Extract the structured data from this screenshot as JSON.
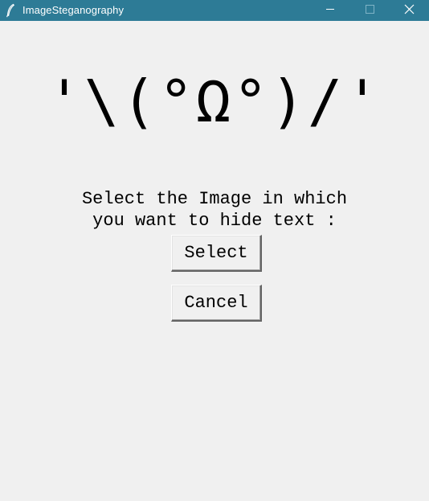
{
  "window": {
    "title": "ImageSteganography",
    "icon": "feather-icon",
    "controls": {
      "minimize": "minimize-icon",
      "maximize": "maximize-icon",
      "close": "close-icon"
    },
    "titlebar_color": "#2d7b96",
    "background_color": "#f0f0f0"
  },
  "main": {
    "face_text": "'\\(°Ω°)/'",
    "prompt_line1": "Select the Image in which",
    "prompt_line2": "you want to hide text :",
    "select_label": "Select",
    "cancel_label": "Cancel"
  }
}
